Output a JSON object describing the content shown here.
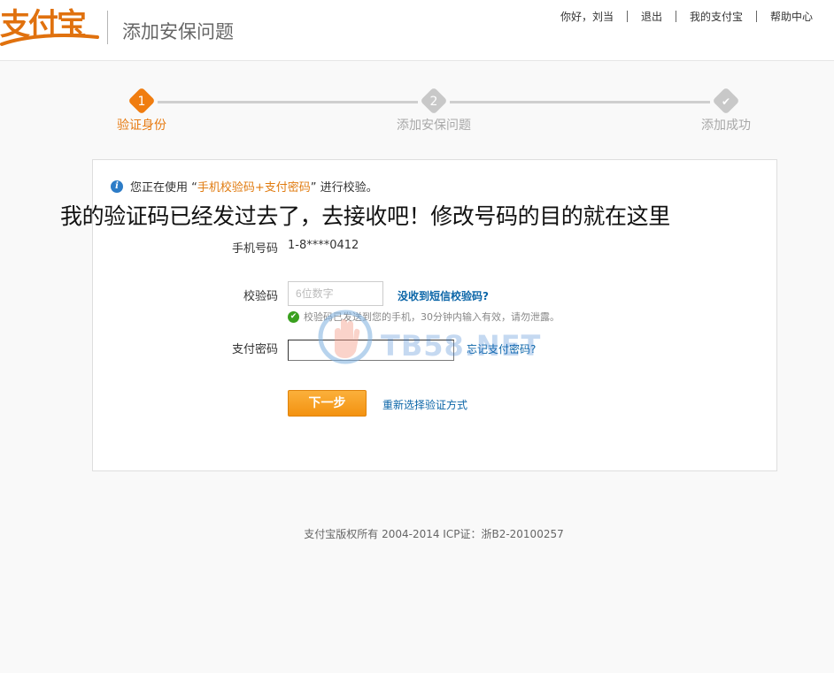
{
  "header": {
    "logo_text": "支付宝",
    "title": "添加安保问题",
    "nav": [
      {
        "label": "你好，刘当"
      },
      {
        "label": "退出"
      },
      {
        "label": "我的支付宝"
      },
      {
        "label": "帮助中心"
      }
    ]
  },
  "steps": [
    {
      "num": "1",
      "label": "验证身份",
      "state": "active"
    },
    {
      "num": "2",
      "label": "添加安保问题",
      "state": "inactive"
    },
    {
      "num": "✔",
      "label": "添加成功",
      "state": "inactive"
    }
  ],
  "notice": {
    "prefix": "您正在使用 “",
    "method": "手机校验码+支付密码",
    "suffix": "” 进行校验。"
  },
  "overlay_caption": "我的验证码已经发过去了，去接收吧！修改号码的目的就在这里",
  "form": {
    "phone_label": "手机号码",
    "phone_value": "1-8****0412",
    "code_label": "校验码",
    "code_placeholder": "6位数字",
    "code_value": "",
    "no_sms_link": "没收到短信校验码?",
    "sms_status": "校验码已发送到您的手机，30分钟内输入有效，请勿泄露。",
    "pwd_label": "支付密码",
    "forgot_link": "忘记支付密码?",
    "next_button": "下一步",
    "reselect_link": "重新选择验证方式"
  },
  "watermark_text": "TB58.NET",
  "footer": {
    "text": "支付宝版权所有 2004-2014 ICP证：浙B2-20100257"
  },
  "colors": {
    "accent": "#f07d10",
    "link": "#0c66a8",
    "success": "#39a01e"
  }
}
